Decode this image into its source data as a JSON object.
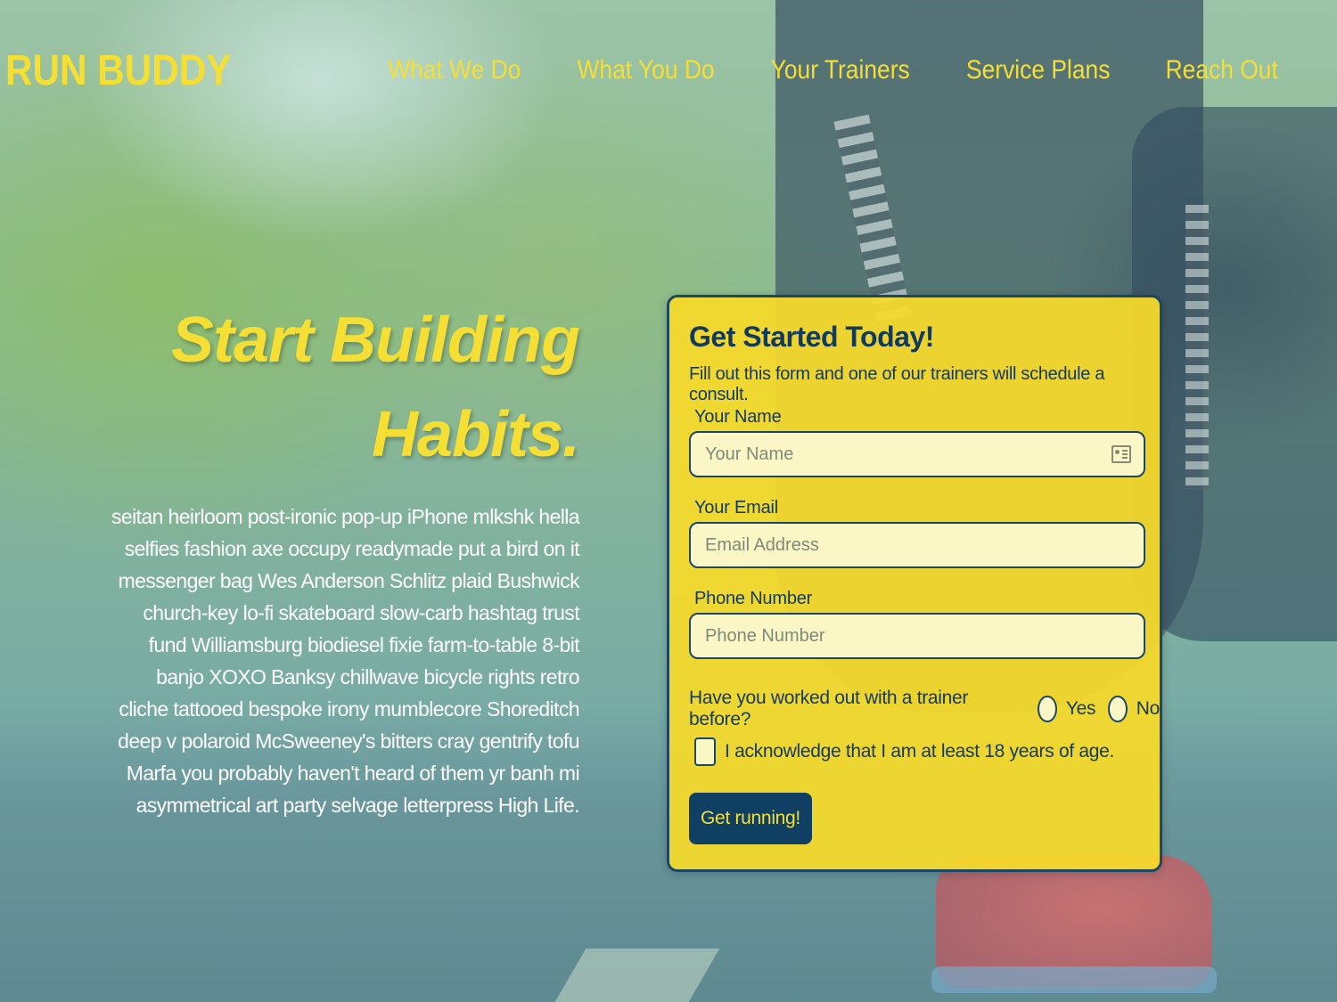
{
  "brand": {
    "logo": "RUN BUDDY"
  },
  "nav": {
    "items": [
      {
        "label": "What We Do"
      },
      {
        "label": "What You Do"
      },
      {
        "label": "Your Trainers"
      },
      {
        "label": "Service Plans"
      },
      {
        "label": "Reach Out"
      }
    ]
  },
  "hero": {
    "title_line1": "Start Building",
    "title_line2": "Habits.",
    "body": "seitan heirloom post-ironic pop-up iPhone mlkshk hella selfies fashion axe occupy readymade put a bird on it messenger bag Wes Anderson Schlitz plaid Bushwick church-key lo-fi skateboard slow-carb hashtag trust fund Williamsburg biodiesel fixie farm-to-table 8-bit banjo XOXO Banksy chillwave bicycle rights retro cliche tattooed bespoke irony mumblecore Shoreditch deep v polaroid McSweeney's bitters cray gentrify tofu Marfa you probably haven't heard of them yr banh mi asymmetrical art party selvage letterpress High Life."
  },
  "form": {
    "title": "Get Started Today!",
    "subtitle": "Fill out this form and one of our trainers will schedule a consult.",
    "name": {
      "label": "Your Name",
      "placeholder": "Your Name",
      "value": ""
    },
    "email": {
      "label": "Your Email",
      "placeholder": "Email Address",
      "value": ""
    },
    "phone": {
      "label": "Phone Number",
      "placeholder": "Phone Number",
      "value": ""
    },
    "trainer_question": {
      "label": "Have you worked out with a trainer before?",
      "options": [
        "Yes",
        "No"
      ],
      "selected": null
    },
    "acknowledge": {
      "label": "I acknowledge that I am at least 18 years of age.",
      "checked": false
    },
    "submit_label": "Get running!"
  },
  "colors": {
    "accent_yellow": "#f6df35",
    "navy": "#123a5c",
    "card_bg": "#f8da2a"
  },
  "icons": {
    "name_field_icon": "contact-card-icon"
  }
}
